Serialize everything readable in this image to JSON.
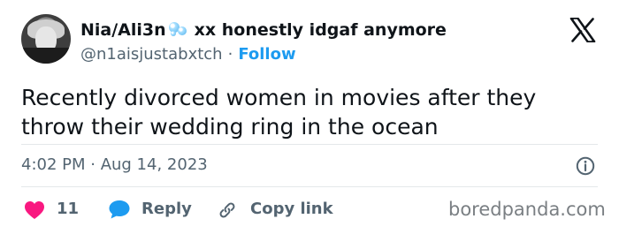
{
  "author": {
    "display_name_start": "Nia/Ali3n",
    "display_name_end": "xx honestly idgaf anymore",
    "handle": "@n1aisjustabxtch",
    "separator": "·",
    "follow_label": "Follow"
  },
  "icons": {
    "avatar": "profile-photo",
    "name_emoji": "bubbles-icon",
    "platform": "x-logo-icon",
    "info": "info-icon",
    "like": "heart-icon",
    "reply": "reply-bubble-icon",
    "copy": "link-icon"
  },
  "tweet": {
    "text": "Recently divorced women in movies after they throw their wedding ring in the ocean",
    "timestamp": "4:02 PM · Aug 14, 2023"
  },
  "actions": {
    "like_count": "11",
    "reply_label": "Reply",
    "copy_label": "Copy link"
  },
  "watermark": "boredpanda.com",
  "colors": {
    "text": "#0f1419",
    "secondary": "#536471",
    "link": "#1d9bf0",
    "heart": "#f91880"
  }
}
